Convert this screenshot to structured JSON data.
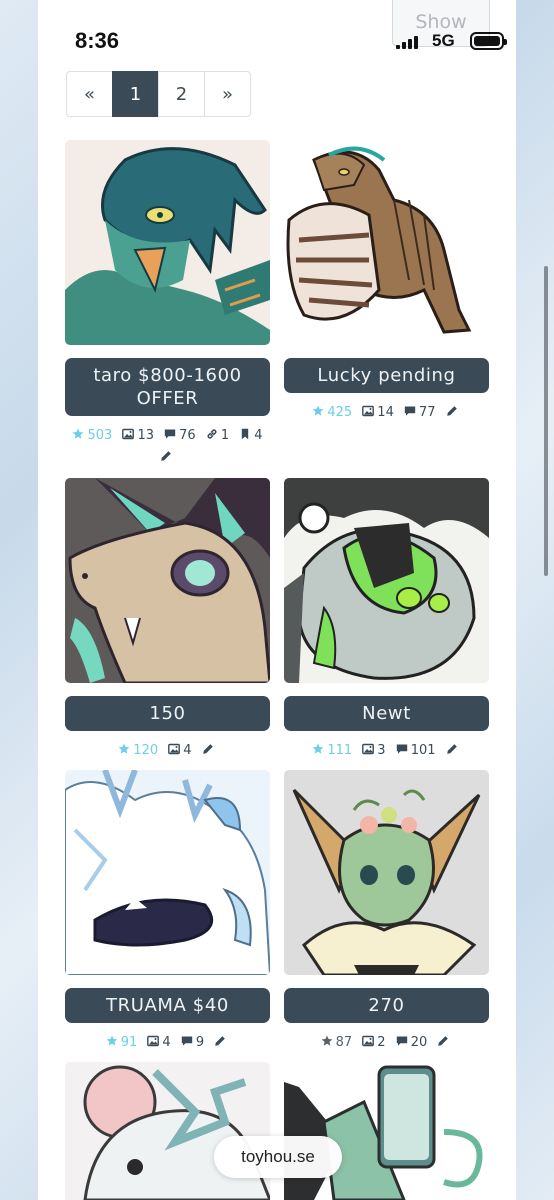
{
  "status_bar": {
    "time": "8:36",
    "network": "5G"
  },
  "show_button": "Show",
  "pagination": {
    "prev": "«",
    "pages": [
      "1",
      "2"
    ],
    "next": "»",
    "active_page": "1"
  },
  "characters": [
    {
      "name": "taro $800-1600 OFFER",
      "favorites": "503",
      "images": "13",
      "comments": "76",
      "links": "1",
      "bookmarks": "4"
    },
    {
      "name": "Lucky pending",
      "favorites": "425",
      "images": "14",
      "comments": "77"
    },
    {
      "name": "150",
      "favorites": "120",
      "images": "4"
    },
    {
      "name": "Newt",
      "favorites": "111",
      "images": "3",
      "comments": "101"
    },
    {
      "name": "TRUAMA $40",
      "favorites": "91",
      "images": "4",
      "comments": "9"
    },
    {
      "name": "270",
      "favorites": "87",
      "images": "2",
      "comments": "20"
    }
  ],
  "url_pill": "toyhou.se",
  "colors": {
    "button_dark": "#3a4b57",
    "favorite": "#6bd0e8",
    "page_bg": "#ffffff"
  }
}
